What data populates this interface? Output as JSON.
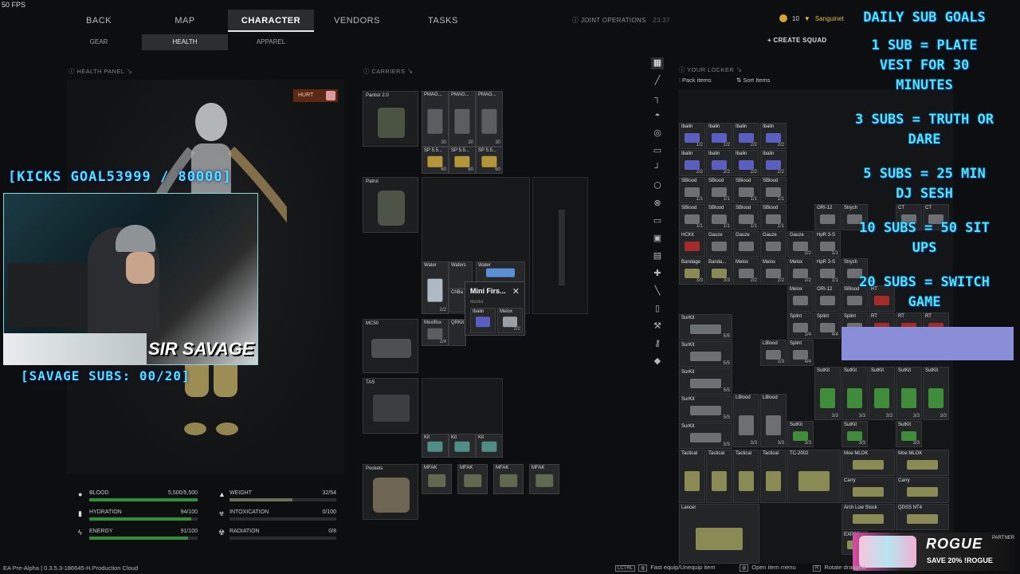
{
  "fps": "50 FPS",
  "nav": {
    "tabs": [
      "BACK",
      "MAP",
      "CHARACTER",
      "VENDORS",
      "TASKS"
    ],
    "active": "CHARACTER",
    "mode": "JOINT OPERATIONS",
    "clock": "23:37",
    "subtabs": [
      "GEAR",
      "HEALTH",
      "APPAREL"
    ],
    "active_sub": "HEALTH"
  },
  "account": {
    "currency": "10",
    "username": "Sanguinet",
    "create_squad": "CREATE SQUAD"
  },
  "health_panel": {
    "title": "HEALTH PANEL",
    "status_badge": "HURT",
    "stats": [
      {
        "label": "BLOOD",
        "value": "5,500/5,500",
        "fill": 1.0
      },
      {
        "label": "HYDRATION",
        "value": "94/100",
        "fill": 0.94
      },
      {
        "label": "ENERGY",
        "value": "91/100",
        "fill": 0.91
      },
      {
        "label": "WEIGHT",
        "value": "32/54",
        "fill": 0.59
      },
      {
        "label": "INTOXICATION",
        "value": "0/100",
        "fill": 0
      },
      {
        "label": "RADIATION",
        "value": "0/8",
        "fill": 0
      }
    ]
  },
  "stream": {
    "kicks_goal": "[KICKS GOAL53999 / 80000]",
    "streamer": "SIR SAVAGE",
    "savage_subs": "[SAVAGE SUBS: 00/20]"
  },
  "carriers": {
    "title": "CARRIERS",
    "pantsir": {
      "name": "Pantsir 2.0",
      "mags": [
        {
          "n": "PMAG...",
          "c": "30"
        },
        {
          "n": "PMAG...",
          "c": "30"
        },
        {
          "n": "PMAG...",
          "c": "30"
        }
      ],
      "ammo": [
        {
          "n": "SP 5.5...",
          "c": "60"
        },
        {
          "n": "SP 5.5...",
          "c": "60"
        },
        {
          "n": "SP 5.5...",
          "c": "60"
        }
      ]
    },
    "patrol": {
      "name": "Patrol",
      "items": [
        {
          "n": "Water",
          "c": "2/2"
        },
        {
          "n": "Wafers",
          "c": ""
        },
        {
          "n": "Water",
          "c": ""
        },
        {
          "n": "ChBa",
          "c": ""
        },
        {
          "n": "Moxiflox",
          "c": "2/4"
        },
        {
          "n": "QRKit",
          "c": ""
        }
      ]
    },
    "mc50": {
      "name": "MC50"
    },
    "tas": {
      "name": "TAS",
      "items": [
        {
          "n": "Kit",
          "c": ""
        },
        {
          "n": "Kit",
          "c": ""
        },
        {
          "n": "Kit",
          "c": ""
        }
      ]
    },
    "pockets": {
      "name": "Pockets",
      "items": [
        {
          "n": "MFAK"
        },
        {
          "n": "MFAK"
        },
        {
          "n": "MFAK"
        },
        {
          "n": "MFAK"
        }
      ]
    },
    "popup": {
      "title": "Mini Firs...",
      "subtitle": "Medkit",
      "items": [
        {
          "n": "Ibalin",
          "c": ""
        },
        {
          "n": "Melox",
          "c": "2/2"
        }
      ]
    }
  },
  "locker": {
    "title": "YOUR LOCKER",
    "pack_items": "Pack items",
    "sort_items": "Sort Items",
    "cells": [
      {
        "n": "Ibalin",
        "c": "1/2",
        "t": "blue"
      },
      {
        "n": "Ibalin",
        "c": "1/2",
        "t": "blue"
      },
      {
        "n": "Ibalin",
        "c": "2/2",
        "t": "blue"
      },
      {
        "n": "Ibalin",
        "c": "2/2",
        "t": "blue"
      },
      {
        "n": "Ibalin",
        "c": "2/2",
        "t": "blue"
      },
      {
        "n": "Ibalin",
        "c": "2/2",
        "t": "blue"
      },
      {
        "n": "Ibalin",
        "c": "2/2",
        "t": "blue"
      },
      {
        "n": "Ibalin",
        "c": "2/2",
        "t": "blue"
      },
      {
        "n": "SBlood",
        "c": "1/1",
        "t": ""
      },
      {
        "n": "SBlood",
        "c": "1/1",
        "t": ""
      },
      {
        "n": "SBlood",
        "c": "1/1",
        "t": ""
      },
      {
        "n": "SBlood",
        "c": "1/1",
        "t": ""
      },
      {
        "n": "SBlood",
        "c": "1/1",
        "t": ""
      },
      {
        "n": "SBlood",
        "c": "1/1",
        "t": ""
      },
      {
        "n": "SBlood",
        "c": "1/1",
        "t": ""
      },
      {
        "n": "SBlood",
        "c": "1/1",
        "t": ""
      },
      {
        "n": "HCKit",
        "c": "",
        "t": "red"
      },
      {
        "n": "Gauze",
        "c": "",
        "t": ""
      },
      {
        "n": "Gauze",
        "c": "",
        "t": ""
      },
      {
        "n": "Gauze",
        "c": "",
        "t": ""
      },
      {
        "n": "Gauze",
        "c": "2/2",
        "t": ""
      },
      {
        "n": "HpR 3-S",
        "c": "1/1",
        "t": ""
      },
      {
        "n": "Bandage",
        "c": "3/3",
        "t": "olive"
      },
      {
        "n": "Banda...",
        "c": "3/3",
        "t": "olive"
      },
      {
        "n": "Melox",
        "c": "2/2",
        "t": ""
      },
      {
        "n": "Melox",
        "c": "2/2",
        "t": ""
      },
      {
        "n": "Melox",
        "c": "2/2",
        "t": ""
      },
      {
        "n": "HpR 3-S",
        "c": "1/1",
        "t": ""
      }
    ],
    "right_cells": [
      {
        "n": "ORI-12",
        "c": ""
      },
      {
        "n": "Strych",
        "c": ""
      },
      {
        "n": "CT",
        "c": ""
      },
      {
        "n": "CT",
        "c": ""
      },
      {
        "n": "Strych",
        "c": ""
      },
      {
        "n": "Melox",
        "c": ""
      },
      {
        "n": "ORI-12",
        "c": ""
      },
      {
        "n": "SBlood",
        "c": ""
      },
      {
        "n": "RT",
        "c": ""
      },
      {
        "n": "Splint",
        "c": "1/4"
      },
      {
        "n": "Splint",
        "c": "4/4"
      },
      {
        "n": "Splint",
        "c": ""
      },
      {
        "n": "RT",
        "c": ""
      },
      {
        "n": "RT",
        "c": ""
      },
      {
        "n": "RT",
        "c": ""
      },
      {
        "n": "LBlood",
        "c": "2/3"
      },
      {
        "n": "Splint",
        "c": "4/4"
      }
    ],
    "surkits": [
      {
        "n": "SurKit",
        "c": "5/5"
      },
      {
        "n": "SurKit",
        "c": "5/5"
      },
      {
        "n": "SurKit",
        "c": "5/5"
      },
      {
        "n": "SurKit",
        "c": "5/5"
      },
      {
        "n": "SurKit",
        "c": "5/5"
      }
    ],
    "sutkits": [
      {
        "n": "SutKit",
        "c": "3/3"
      },
      {
        "n": "SutKit",
        "c": "3/3"
      },
      {
        "n": "SutKit",
        "c": "3/3"
      },
      {
        "n": "SutKit",
        "c": "3/3"
      },
      {
        "n": "SutKit",
        "c": "3/3"
      },
      {
        "n": "SutKit",
        "c": "3/3"
      },
      {
        "n": "SutKit",
        "c": "3/3"
      },
      {
        "n": "SutKit",
        "c": "3/3"
      }
    ],
    "lbloods": [
      {
        "n": "LBlood",
        "c": "3/3"
      },
      {
        "n": "LBlood",
        "c": "3/3"
      }
    ],
    "bottom": [
      {
        "n": "Tactical"
      },
      {
        "n": "Tactical"
      },
      {
        "n": "Tactical"
      },
      {
        "n": "Tactical"
      },
      {
        "n": "TC-2002"
      },
      {
        "n": "Moe MLOK"
      },
      {
        "n": "Moe MLOK"
      },
      {
        "n": "Carry"
      },
      {
        "n": "Carry"
      },
      {
        "n": "Lancer"
      },
      {
        "n": "Arch Low Stock"
      },
      {
        "n": "QDSS NT4"
      },
      {
        "n": "EXPS3"
      }
    ]
  },
  "goals": {
    "title": "DAILY SUB GOALS",
    "lines": [
      "1 SUB = PLATE VEST FOR 30 MINUTES",
      "3 SUBS = TRUTH OR DARE",
      "5 SUBS = 25 MIN DJ SESH",
      "10 SUBS = 50 SIT UPS",
      "20 SUBS = SWITCH GAME"
    ]
  },
  "bottom_bar": {
    "version": "EA Pre-Alpha | 0.3.5.3-186645-H.Production Cloud",
    "hints": [
      {
        "key": "LCTRL",
        "text": "Fast equip/Unequip item"
      },
      {
        "key": "",
        "text": "Open item menu"
      },
      {
        "key": "R",
        "text": "Rotate dragged"
      }
    ]
  },
  "sponsor": {
    "brand": "ROGUE",
    "tag": "PARTNER",
    "promo": "SAVE 20% !ROGUE"
  }
}
